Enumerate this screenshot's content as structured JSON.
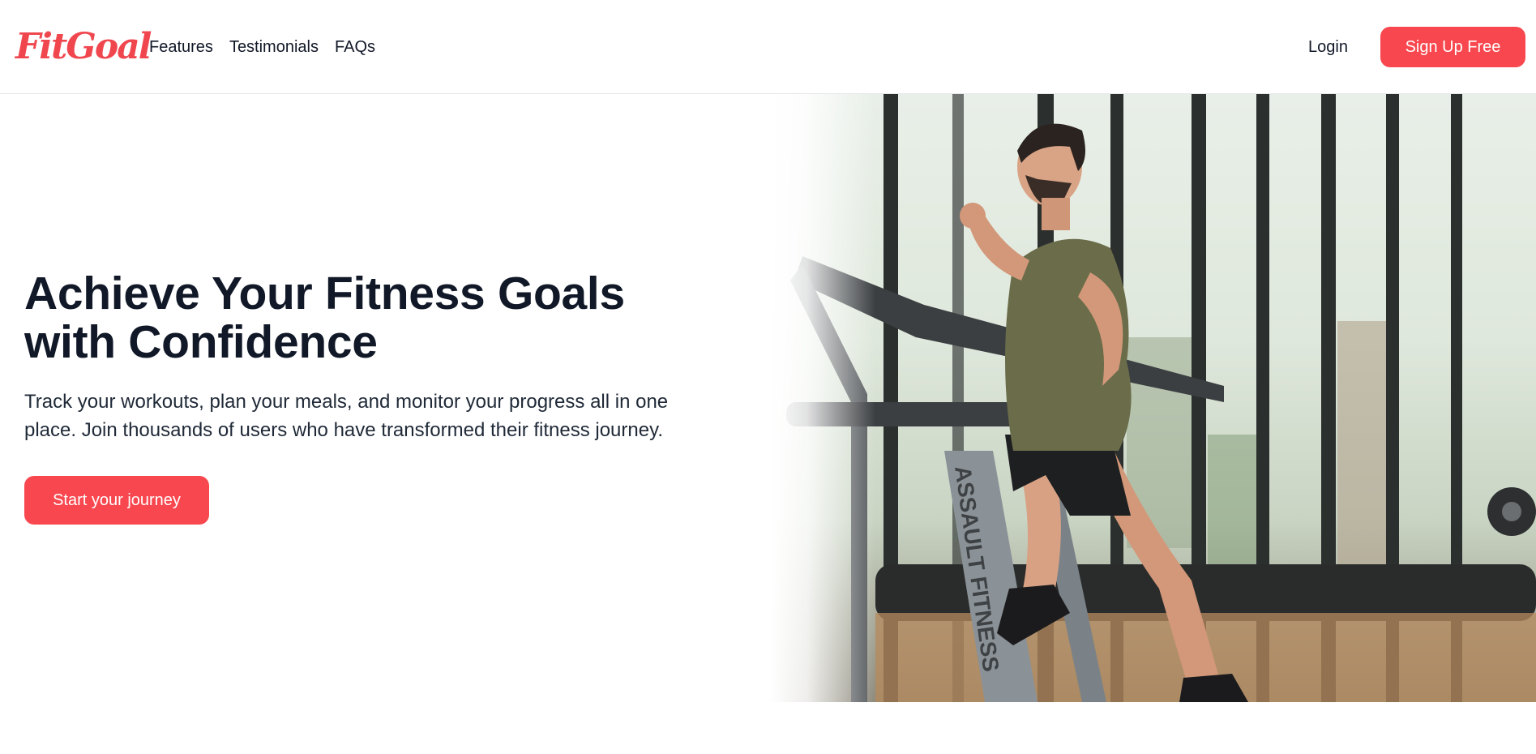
{
  "brand": {
    "name": "FitGoal",
    "color": "#f0474f"
  },
  "nav": {
    "links": [
      "Features",
      "Testimonials",
      "FAQs"
    ],
    "login_label": "Login",
    "signup_label": "Sign Up Free"
  },
  "hero": {
    "title": "Achieve Your Fitness Goals with Confidence",
    "subtitle": "Track your workouts, plan your meals, and monitor your progress all in one place. Join thousands of users who have transformed their fitness journey.",
    "cta_label": "Start your journey",
    "image_subject": "man running on treadmill in gym",
    "treadmill_brand_text": "ASSAULT FITNESS"
  },
  "colors": {
    "accent": "#f8474e",
    "text": "#111827",
    "background": "#ffffff"
  }
}
